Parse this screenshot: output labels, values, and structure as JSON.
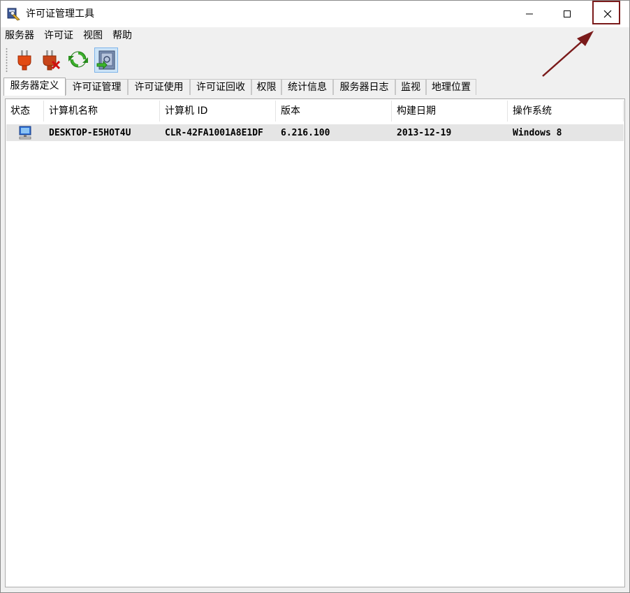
{
  "window": {
    "title": "许可证管理工具",
    "controls": {
      "minimize": "—",
      "maximize": "☐",
      "close": "✕"
    }
  },
  "menu": [
    "服务器",
    "许可证",
    "视图",
    "帮助"
  ],
  "toolbar": {
    "buttons": [
      "plug-connect-icon",
      "plug-disconnect-icon",
      "refresh-icon",
      "export-icon"
    ]
  },
  "tabs": [
    "服务器定义",
    "许可证管理",
    "许可证使用",
    "许可证回收",
    "权限",
    "统计信息",
    "服务器日志",
    "监视",
    "地理位置"
  ],
  "table": {
    "columns": [
      "状态",
      "计算机名称",
      "计算机 ID",
      "版本",
      "构建日期",
      "操作系统"
    ],
    "rows": [
      {
        "status_icon": "computer-icon",
        "name": "DESKTOP-E5HOT4U",
        "id": "CLR-42FA1001A8E1DF",
        "version": "6.216.100",
        "build_date": "2013-12-19",
        "os": "Windows 8"
      }
    ]
  },
  "colors": {
    "highlight_box": "#7a1a1a",
    "arrow": "#7a1a1a",
    "selected_row": "#e5e5e5"
  }
}
